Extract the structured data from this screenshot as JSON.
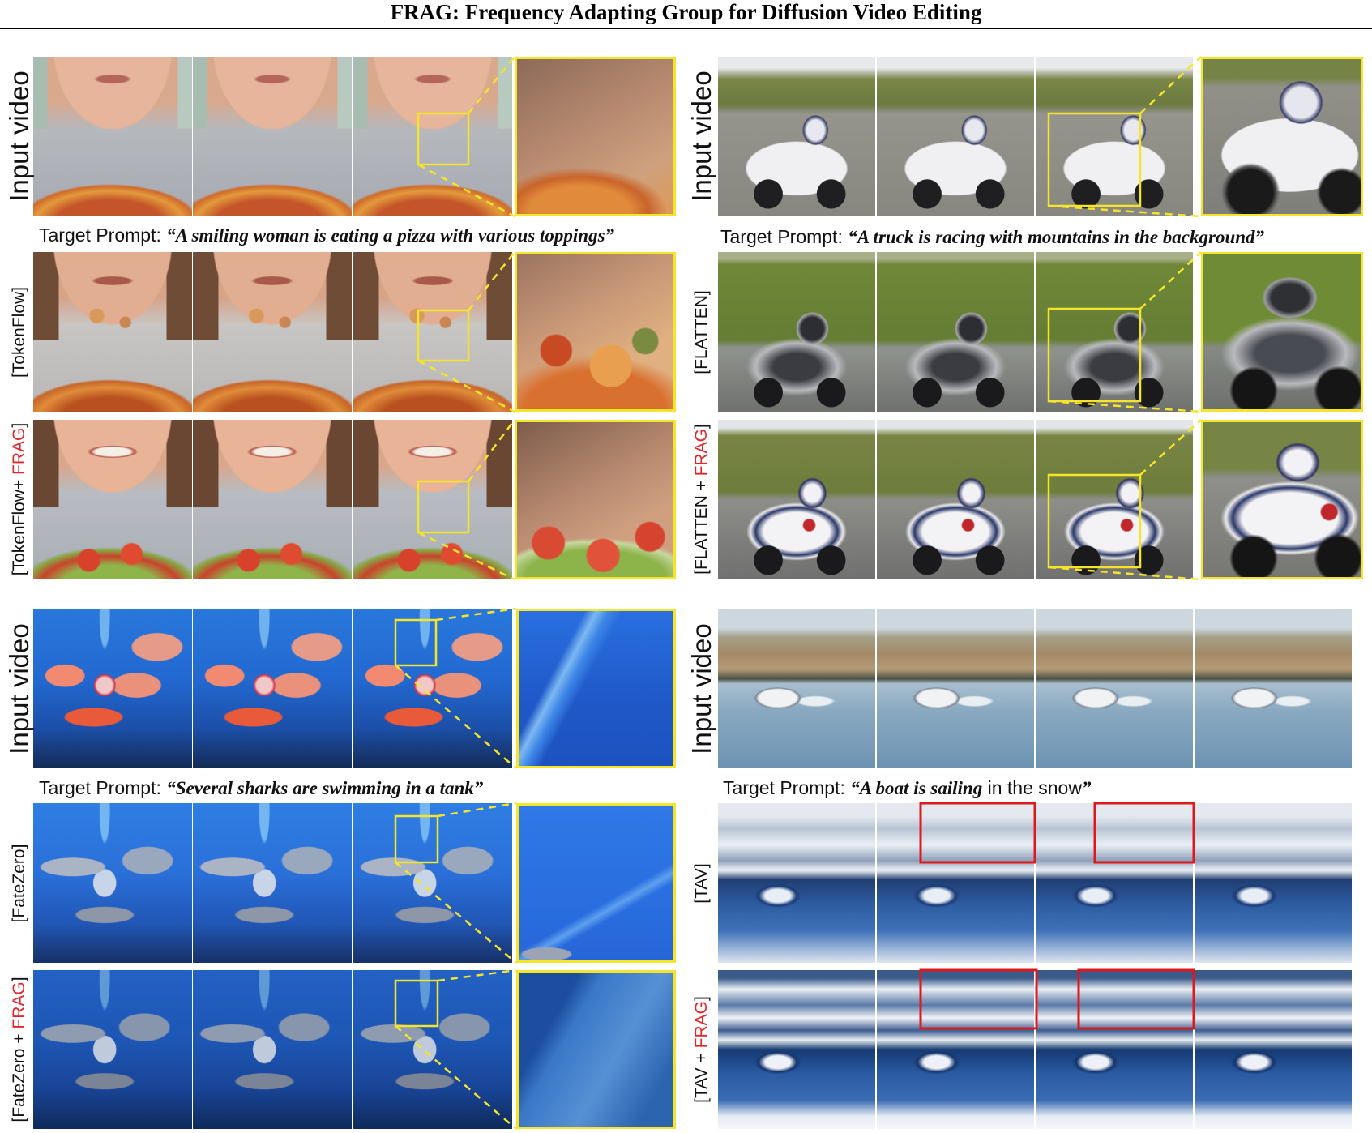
{
  "title": "FRAG: Frequency Adapting Group for Diffusion Video Editing",
  "panels": {
    "pizza": {
      "input_label": "Input video",
      "prompt": {
        "prefix": "Target Prompt: ",
        "quote_bold": "“A smiling woman is eating a pizza with various toppings”"
      },
      "baseline_label": "[TokenFlow]",
      "frag_label": {
        "pre": "[TokenFlow+ ",
        "highlight": "FRAG",
        "post": "]"
      }
    },
    "truck": {
      "input_label": "Input video",
      "prompt": {
        "prefix": "Target Prompt: ",
        "quote_bold": "“A truck is racing with mountains in the background”"
      },
      "baseline_label": "[FLATTEN]",
      "frag_label": {
        "pre": "[FLATTEN + ",
        "highlight": "FRAG",
        "post": "]"
      }
    },
    "fish": {
      "input_label": "Input video",
      "prompt": {
        "prefix": "Target Prompt: ",
        "quote_bold": "“Several sharks are swimming in a tank”"
      },
      "baseline_label": "[FateZero]",
      "frag_label": {
        "pre": "[FateZero + ",
        "highlight": "FRAG",
        "post": "]"
      }
    },
    "boat": {
      "input_label": "Input video",
      "prompt": {
        "prefix": "Target Prompt: ",
        "quote_bold": "“A boat is sailing",
        "quote_plain": " in the snow",
        "quote_end": "”"
      },
      "baseline_label": "[TAV]",
      "frag_label": {
        "pre": "[TAV + ",
        "highlight": "FRAG",
        "post": "]"
      }
    }
  },
  "colors": {
    "frag_highlight": "#e3262a",
    "zoom_box": "#f5e52a",
    "artifact_box": "#e0181c"
  }
}
